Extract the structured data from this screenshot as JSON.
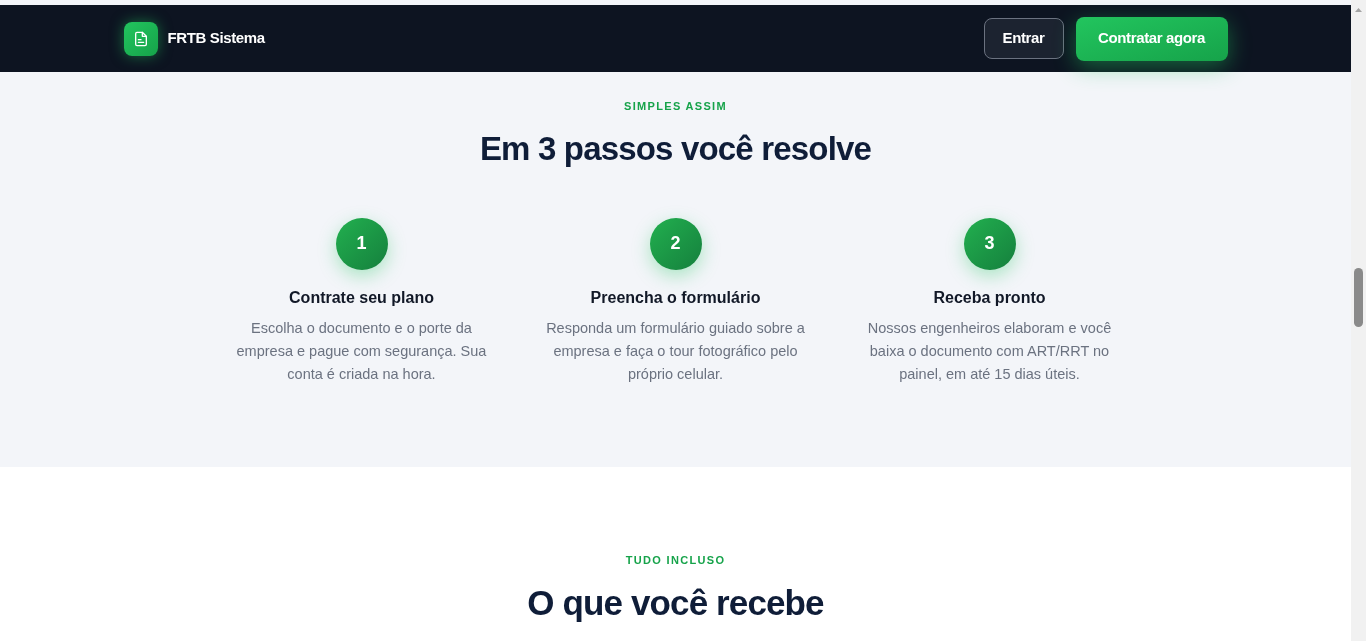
{
  "header": {
    "brand": "FRTB Sistema",
    "buttons": [
      {
        "label": "Entrar",
        "kind": "outline"
      },
      {
        "label": "Contratar agora",
        "kind": "primary"
      }
    ]
  },
  "steps_section": {
    "eyebrow": "SIMPLES ASSIM",
    "title": "Em 3 passos você resolve",
    "steps": [
      {
        "number": "1",
        "title": "Contrate seu plano",
        "description": "Escolha o documento e o porte da empresa e pague com segurança. Sua conta é criada na hora."
      },
      {
        "number": "2",
        "title": "Preencha o formulário",
        "description": "Responda um formulário guiado sobre a empresa e faça o tour fotográfico pelo próprio celular."
      },
      {
        "number": "3",
        "title": "Receba pronto",
        "description": "Nossos engenheiros elaboram e você baixa o documento com ART/RRT no painel, em até 15 dias úteis."
      }
    ]
  },
  "features_section": {
    "eyebrow": "TUDO INCLUSO",
    "title": "O que você recebe"
  }
}
